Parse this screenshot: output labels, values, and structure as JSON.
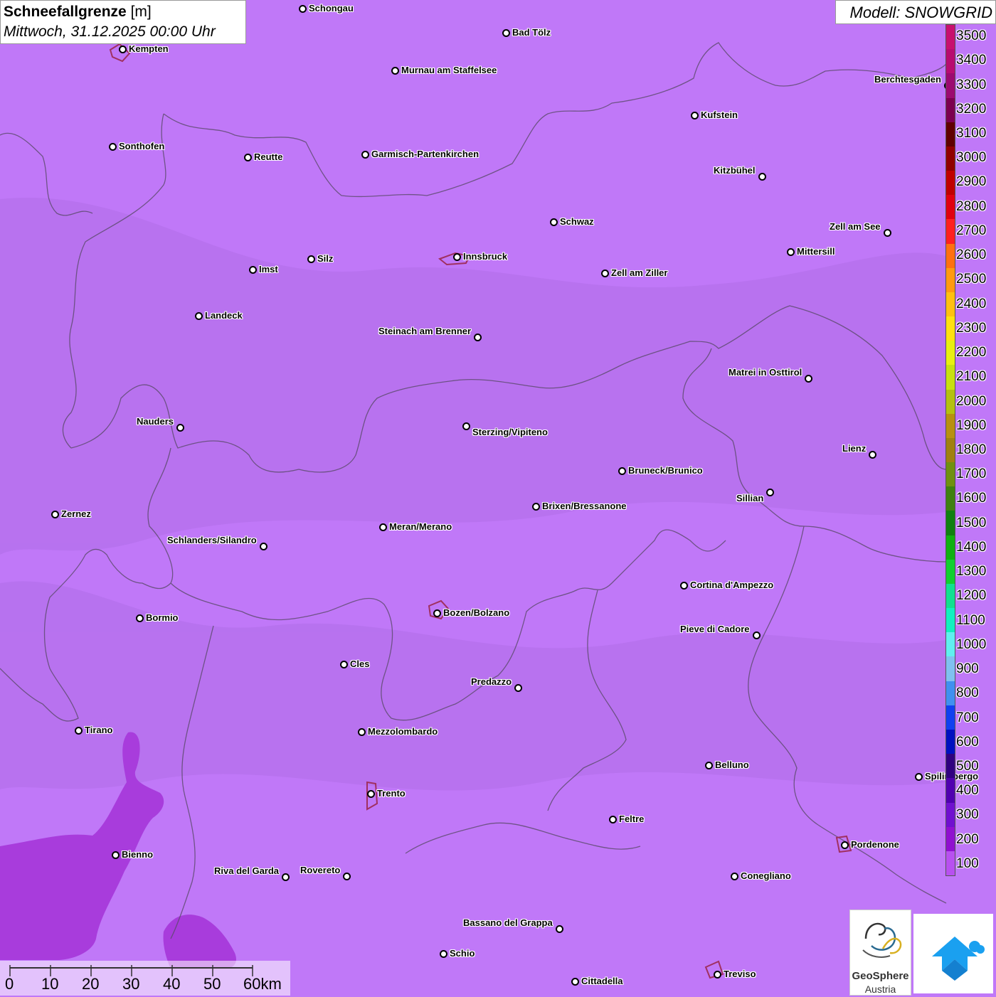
{
  "title": {
    "main": "Schneefallgrenze",
    "unit": "[m]",
    "datetime": "Mittwoch, 31.12.2025 00:00 Uhr"
  },
  "model": "Modell: SNOWGRID",
  "colors": {
    "background": "#c078f8",
    "low_zone": "#a83cdc",
    "border_line": "#5a4a6a"
  },
  "cities": [
    {
      "name": "Schongau"
    },
    {
      "name": "Bad Tölz"
    },
    {
      "name": "Kempten"
    },
    {
      "name": "Murnau am Staffelsee"
    },
    {
      "name": "Berchtesgaden"
    },
    {
      "name": "Kufstein"
    },
    {
      "name": "Sonthofen"
    },
    {
      "name": "Reutte"
    },
    {
      "name": "Garmisch-Partenkirchen"
    },
    {
      "name": "Kitzbühel"
    },
    {
      "name": "Schwaz"
    },
    {
      "name": "Zell am See"
    },
    {
      "name": "Innsbruck"
    },
    {
      "name": "Mittersill"
    },
    {
      "name": "Silz"
    },
    {
      "name": "Imst"
    },
    {
      "name": "Zell am Ziller"
    },
    {
      "name": "Landeck"
    },
    {
      "name": "Steinach am Brenner"
    },
    {
      "name": "Matrei in Osttirol"
    },
    {
      "name": "Nauders"
    },
    {
      "name": "Sterzing/Vipiteno"
    },
    {
      "name": "Lienz"
    },
    {
      "name": "Bruneck/Brunico"
    },
    {
      "name": "Sillian"
    },
    {
      "name": "Brixen/Bressanone"
    },
    {
      "name": "Zernez"
    },
    {
      "name": "Meran/Merano"
    },
    {
      "name": "Schlanders/Silandro"
    },
    {
      "name": "Cortina d'Ampezzo"
    },
    {
      "name": "Bozen/Bolzano"
    },
    {
      "name": "Bormio"
    },
    {
      "name": "Pieve di Cadore"
    },
    {
      "name": "Cles"
    },
    {
      "name": "Predazzo"
    },
    {
      "name": "Tirano"
    },
    {
      "name": "Mezzolombardo"
    },
    {
      "name": "Belluno"
    },
    {
      "name": "Spilimbergo"
    },
    {
      "name": "Trento"
    },
    {
      "name": "Feltre"
    },
    {
      "name": "Pordenone"
    },
    {
      "name": "Bienno"
    },
    {
      "name": "Riva del Garda"
    },
    {
      "name": "Rovereto"
    },
    {
      "name": "Conegliano"
    },
    {
      "name": "Bassano del Grappa"
    },
    {
      "name": "Schio"
    },
    {
      "name": "Treviso"
    },
    {
      "name": "Cittadella"
    }
  ],
  "legend": {
    "labels": [
      "3500",
      "3400",
      "3300",
      "3200",
      "3100",
      "3000",
      "2900",
      "2800",
      "2700",
      "2600",
      "2500",
      "2400",
      "2300",
      "2200",
      "2100",
      "2000",
      "1900",
      "1800",
      "1700",
      "1600",
      "1500",
      "1400",
      "1300",
      "1200",
      "1100",
      "1000",
      "900",
      "800",
      "700",
      "600",
      "500",
      "400",
      "300",
      "200",
      "100"
    ],
    "colors": [
      "#c8106e",
      "#b80c70",
      "#9c0a70",
      "#7c0050",
      "#600000",
      "#900000",
      "#c00000",
      "#e00010",
      "#ff2020",
      "#ff7010",
      "#ff9a10",
      "#ffc010",
      "#ffe010",
      "#e8f010",
      "#c8e010",
      "#b4c010",
      "#b89010",
      "#a08010",
      "#709010",
      "#408010",
      "#108010",
      "#10b010",
      "#10d030",
      "#10e090",
      "#10f0c0",
      "#60f0f0",
      "#80c0f0",
      "#4090f0",
      "#1040f0",
      "#0010c0",
      "#300080",
      "#5000b0",
      "#7010d0",
      "#9010d0",
      "#b850f0"
    ]
  },
  "scalebar": {
    "labels": [
      "0",
      "10",
      "20",
      "30",
      "40",
      "50",
      "60km"
    ]
  },
  "logos": {
    "geosphere_line1": "GeoSphere",
    "geosphere_line2": "Austria"
  }
}
